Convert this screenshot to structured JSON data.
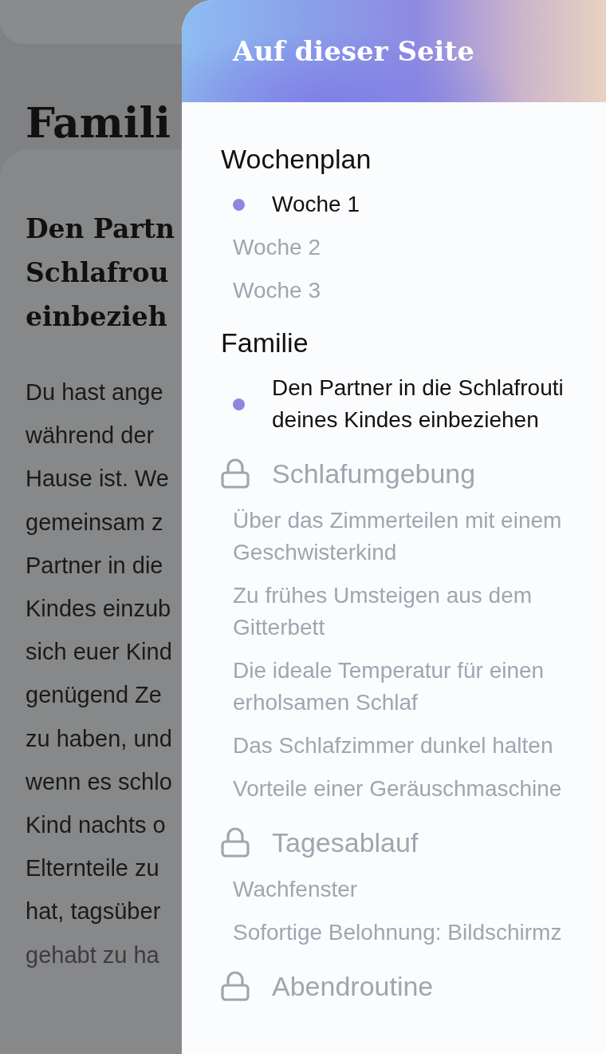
{
  "page": {
    "title": "Famili",
    "article": {
      "heading_lines": [
        "Den Partn",
        "Schlafrou",
        "einbezieh"
      ],
      "body_lines": [
        "Du hast ange",
        "während der",
        "Hause ist. We",
        "gemeinsam z",
        "Partner in die",
        "Kindes einzub",
        "sich euer Kind",
        "genügend Ze",
        "zu haben, und",
        "wenn es schlo",
        "Kind nachts o",
        "Elternteile zu",
        "hat, tagsüber",
        "gehabt zu ha"
      ]
    }
  },
  "drawer": {
    "title": "Auf dieser Seite",
    "sections": [
      {
        "title": "Wochenplan",
        "locked": false,
        "items": [
          {
            "label": "Woche 1",
            "selected": true
          },
          {
            "label": "Woche 2",
            "selected": false
          },
          {
            "label": "Woche 3",
            "selected": false
          }
        ]
      },
      {
        "title": "Familie",
        "locked": false,
        "items": [
          {
            "label": "Den Partner in die Schlafrouti deines Kindes einbeziehen",
            "selected": true
          }
        ]
      },
      {
        "title": "Schlafumgebung",
        "locked": true,
        "items": [
          {
            "label": "Über das Zimmerteilen mit einem Geschwisterkind",
            "selected": false
          },
          {
            "label": "Zu frühes Umsteigen aus dem Gitterbett",
            "selected": false
          },
          {
            "label": "Die ideale Temperatur für einen erholsamen Schlaf",
            "selected": false
          },
          {
            "label": "Das Schlafzimmer dunkel halten",
            "selected": false
          },
          {
            "label": "Vorteile einer Geräuschmaschine",
            "selected": false
          }
        ]
      },
      {
        "title": "Tagesablauf",
        "locked": true,
        "items": [
          {
            "label": "Wachfenster",
            "selected": false
          },
          {
            "label": "Sofortige Belohnung: Bildschirmz",
            "selected": false
          }
        ]
      },
      {
        "title": "Abendroutine",
        "locked": true
      }
    ]
  }
}
